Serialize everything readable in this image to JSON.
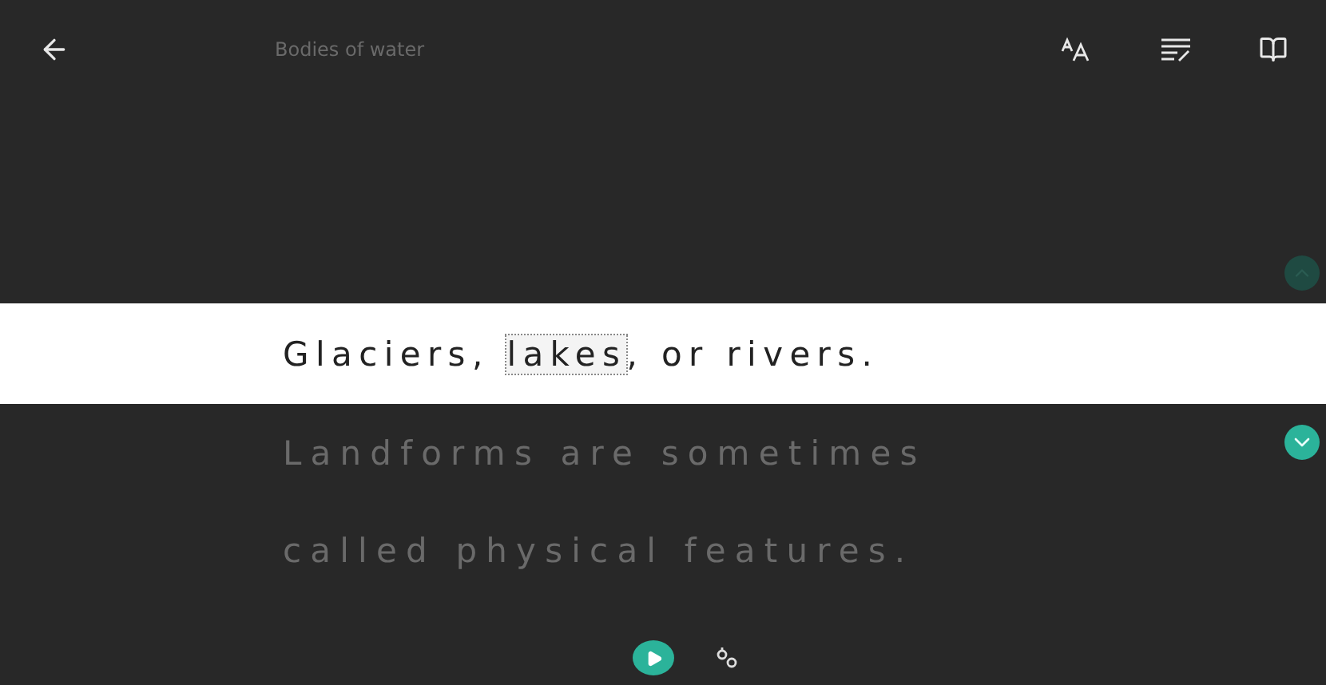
{
  "header": {
    "title": "Bodies of water"
  },
  "lines": [
    {
      "focused": true,
      "segments": [
        {
          "text": "Glaciers, ",
          "selected": false
        },
        {
          "text": "lakes",
          "selected": true
        },
        {
          "text": ", or rivers.",
          "selected": false
        }
      ]
    },
    {
      "focused": false,
      "segments": [
        {
          "text": "Landforms are sometimes",
          "selected": false
        }
      ]
    },
    {
      "focused": false,
      "segments": [
        {
          "text": "called physical features.",
          "selected": false
        }
      ]
    }
  ]
}
